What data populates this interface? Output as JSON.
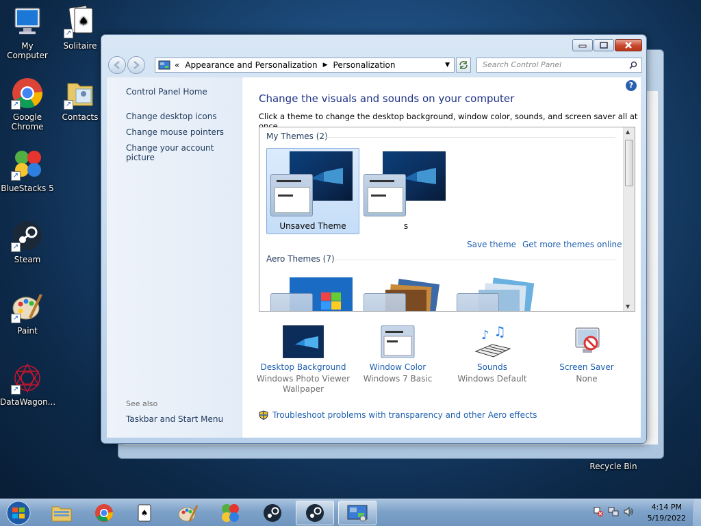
{
  "desktop": {
    "icons": [
      {
        "label": "My Computer",
        "icon": "computer-icon"
      },
      {
        "label": "Solitaire",
        "icon": "solitaire-icon"
      },
      {
        "label": "Google Chrome",
        "icon": "chrome-icon"
      },
      {
        "label": "Contacts",
        "icon": "contacts-icon"
      },
      {
        "label": "BlueStacks 5",
        "icon": "bluestacks-icon"
      },
      {
        "label": "Steam",
        "icon": "steam-icon"
      },
      {
        "label": "Paint",
        "icon": "paint-icon"
      },
      {
        "label": "DataWagon...",
        "icon": "datawagon-icon"
      },
      {
        "label": "Recycle Bin",
        "icon": "recycle-bin-icon"
      }
    ]
  },
  "window": {
    "breadcrumb": {
      "prefix": "«",
      "items": [
        "Appearance and Personalization",
        "Personalization"
      ]
    },
    "search_placeholder": "Search Control Panel",
    "left_pane": {
      "home_link": "Control Panel Home",
      "links": [
        "Change desktop icons",
        "Change mouse pointers",
        "Change your account picture"
      ],
      "see_also_label": "See also",
      "see_also_links": [
        "Taskbar and Start Menu"
      ]
    },
    "main": {
      "title": "Change the visuals and sounds on your computer",
      "subtitle": "Click a theme to change the desktop background, window color, sounds, and screen saver all at once.",
      "my_themes_header": "My Themes (2)",
      "my_themes": [
        {
          "name": "Unsaved Theme",
          "selected": true
        },
        {
          "name": "s",
          "selected": false
        }
      ],
      "save_theme": "Save theme",
      "get_more": "Get more themes online",
      "aero_themes_header": "Aero Themes (7)"
    },
    "bottom": [
      {
        "label": "Desktop Background",
        "value": "Windows Photo Viewer Wallpaper",
        "icon": "desktop-background-icon"
      },
      {
        "label": "Window Color",
        "value": "Windows 7 Basic",
        "icon": "window-color-icon"
      },
      {
        "label": "Sounds",
        "value": "Windows Default",
        "icon": "sounds-icon"
      },
      {
        "label": "Screen Saver",
        "value": "None",
        "icon": "screen-saver-icon"
      }
    ],
    "troubleshoot": "Troubleshoot problems with transparency and other Aero effects"
  },
  "taskbar": {
    "time": "4:14 PM",
    "date": "5/19/2022"
  }
}
